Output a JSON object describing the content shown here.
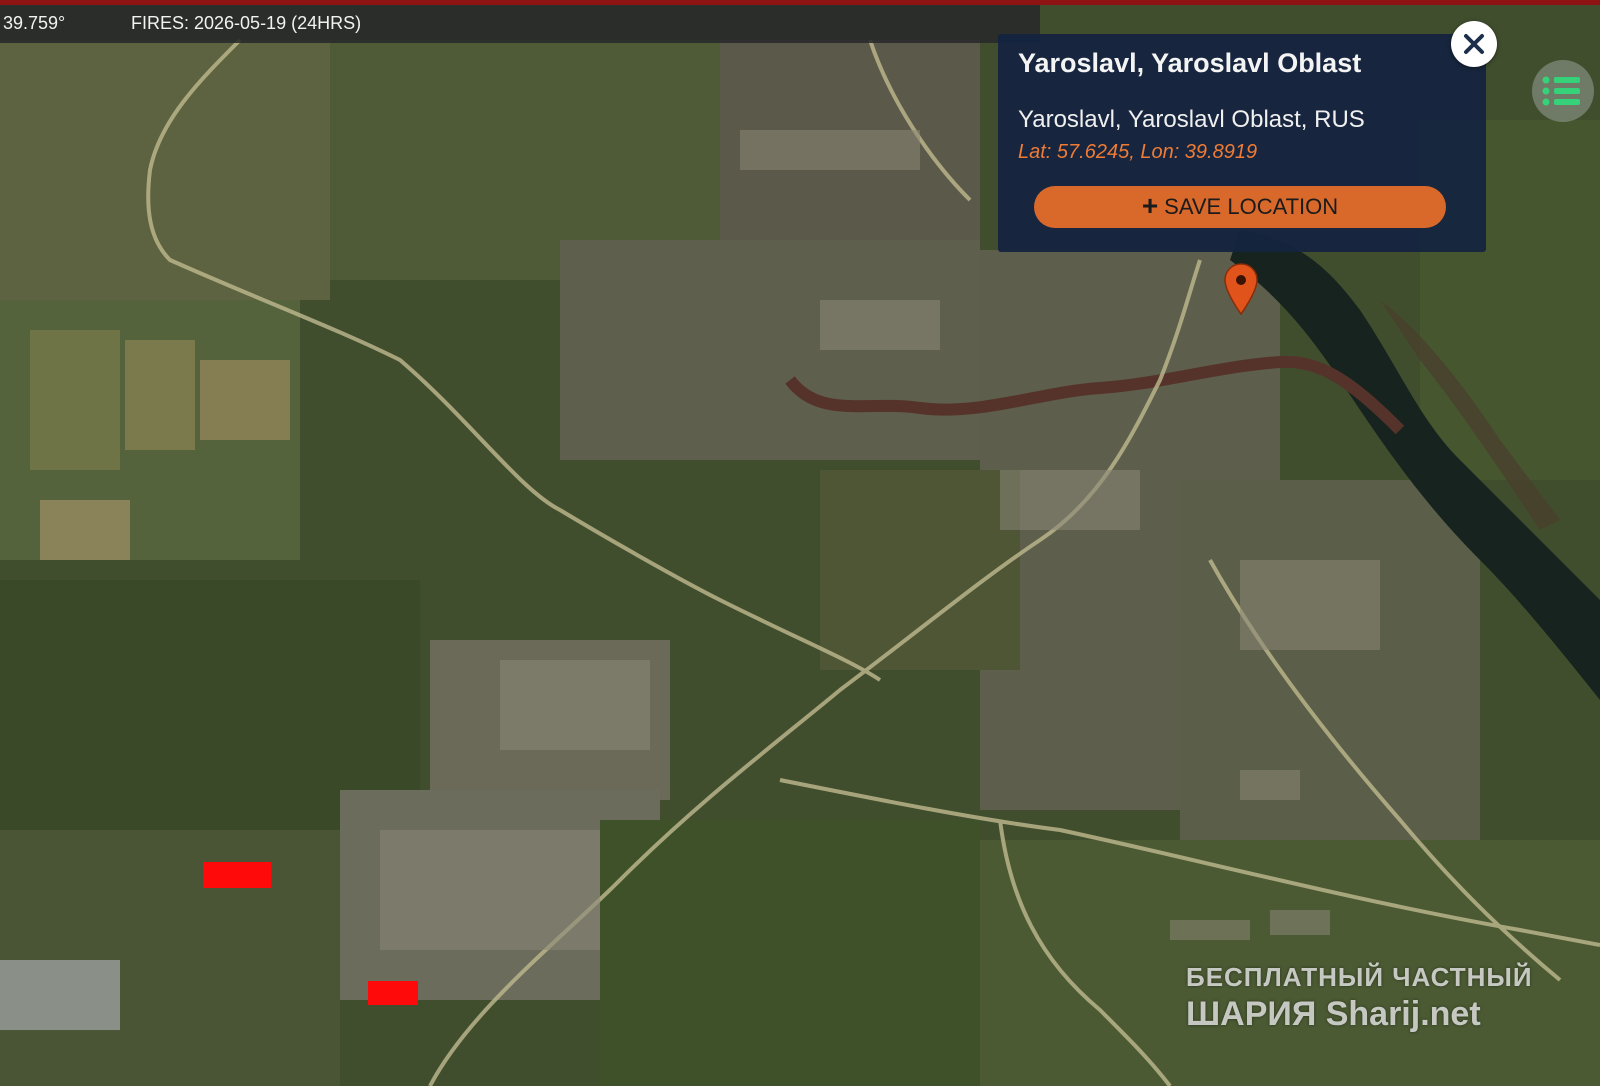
{
  "topbar": {
    "coordinate": "39.759°",
    "fires": "FIRES: 2026-05-19 (24HRS)"
  },
  "popup": {
    "title": "Yaroslavl, Yaroslavl Oblast",
    "subtitle": "Yaroslavl, Yaroslavl Oblast, RUS",
    "latlon": "Lat: 57.6245, Lon: 39.8919",
    "save_label": "SAVE LOCATION",
    "save_icon": "plus-icon"
  },
  "controls": {
    "close_icon": "close-icon",
    "menu_icon": "list-menu-icon",
    "marker_icon": "location-pin-icon"
  },
  "fire_markers": [
    "fire-hotspot",
    "fire-hotspot"
  ],
  "watermark": {
    "line1": "БЕСПЛАТНЫЙ ЧАСТНЫЙ",
    "line2": "ШАРИЯ Sharij.net"
  },
  "colors": {
    "accent": "#d9692b",
    "popup_bg": "#142440",
    "fire": "#ff0a0a",
    "top_line": "#8e1414"
  }
}
